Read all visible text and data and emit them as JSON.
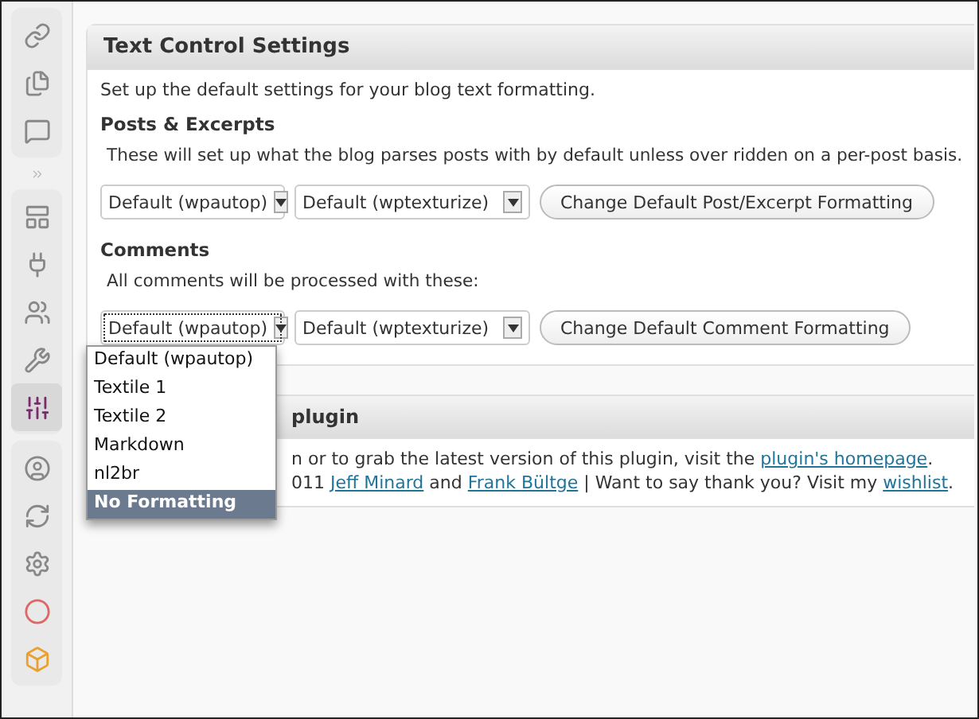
{
  "sidebar": {
    "items": [
      {
        "selected": false
      },
      {
        "selected": false
      },
      {
        "selected": false
      },
      {
        "selected": false
      },
      {
        "selected": false
      },
      {
        "selected": false
      },
      {
        "selected": false
      },
      {
        "selected": true
      },
      {
        "selected": false
      },
      {
        "selected": false
      },
      {
        "selected": false
      },
      {
        "selected": false
      },
      {
        "selected": false
      }
    ]
  },
  "settings_panel": {
    "title": "Text Control Settings",
    "intro": "Set up the default settings for your blog text formatting.",
    "sections": [
      {
        "heading": "Posts & Excerpts",
        "description": "These will set up what the blog parses posts with by default unless over ridden on a per-post basis.",
        "format_select": {
          "value": "Default (wpautop)",
          "focused": false
        },
        "texturize_select": {
          "value": "Default (wptexturize)"
        },
        "button": "Change Default Post/Excerpt Formatting"
      },
      {
        "heading": "Comments",
        "description": "All comments will be processed with these:",
        "format_select": {
          "value": "Default (wpautop)",
          "focused": true
        },
        "texturize_select": {
          "value": "Default (wptexturize)"
        },
        "button": "Change Default Comment Formatting"
      }
    ]
  },
  "dropdown": {
    "options": [
      {
        "label": "Default (wpautop)",
        "selected": false
      },
      {
        "label": "Textile 1",
        "selected": false
      },
      {
        "label": "Textile 2",
        "selected": false
      },
      {
        "label": "Markdown",
        "selected": false
      },
      {
        "label": "nl2br",
        "selected": false
      },
      {
        "label": "No Formatting",
        "selected": true
      }
    ]
  },
  "about_panel": {
    "title": "plugin",
    "lines": [
      [
        {
          "text": "n or to grab the latest version of this plugin, visit the "
        },
        {
          "text": "plugin's homepage",
          "link": true
        },
        {
          "text": "."
        }
      ],
      [
        {
          "text": "011 "
        },
        {
          "text": "Jeff Minard",
          "link": true
        },
        {
          "text": " and "
        },
        {
          "text": "Frank Bültge",
          "link": true
        },
        {
          "text": " | Want to say thank you? Visit my "
        },
        {
          "text": "wishlist",
          "link": true
        },
        {
          "text": "."
        }
      ]
    ]
  }
}
